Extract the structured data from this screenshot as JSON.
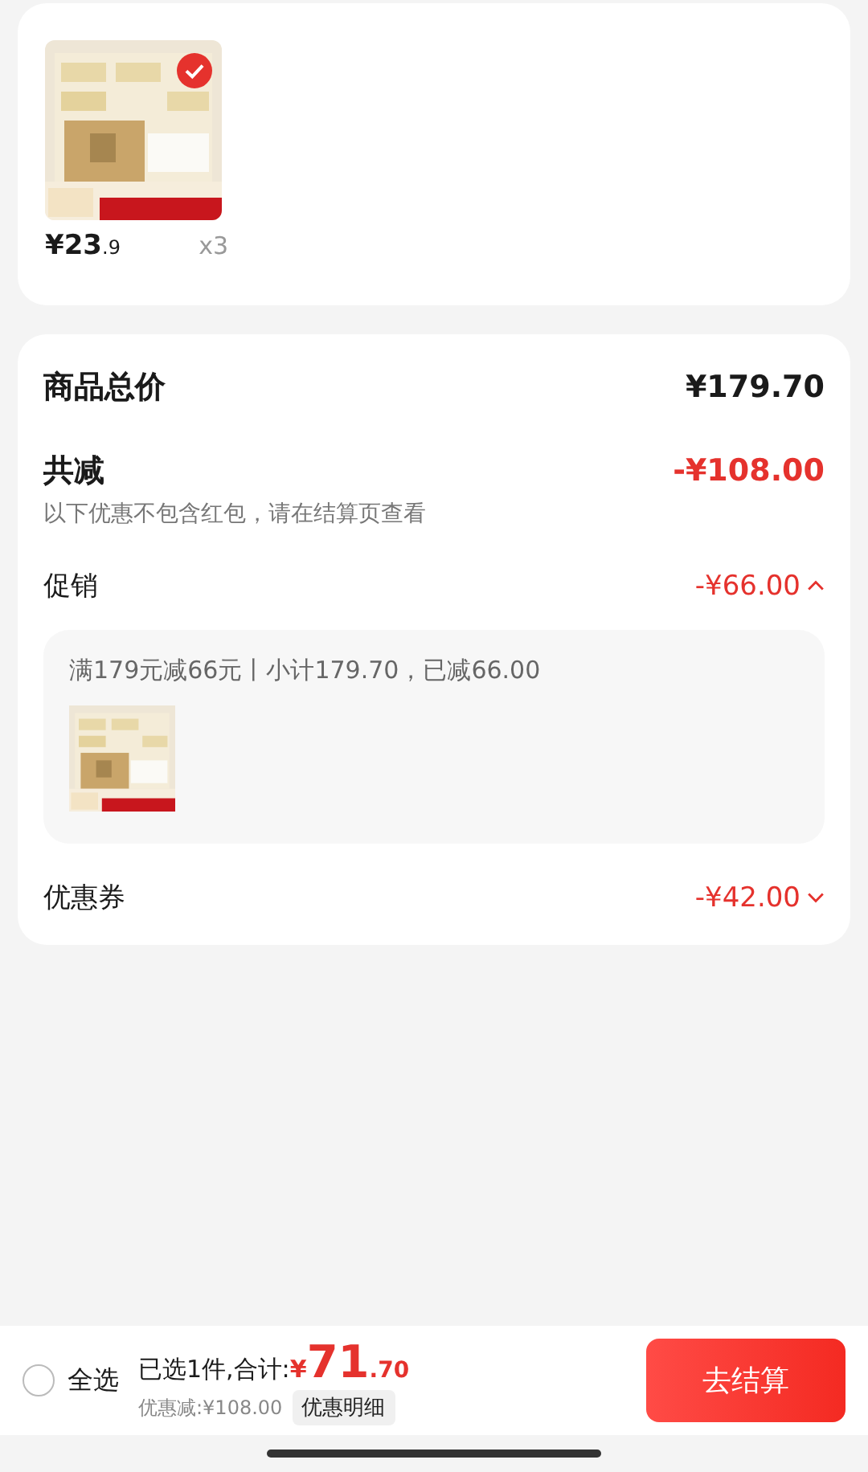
{
  "product_card": {
    "items": [
      {
        "kind": "picture",
        "selected": true,
        "price_main": "¥23",
        "price_decimal": ".9",
        "quantity": "x3"
      }
    ]
  },
  "summary": {
    "total_label": "商品总价",
    "total_value": "¥179.70",
    "discount_label": "共减",
    "discount_value": "-¥108.00",
    "note": "以下优惠不包含红包，请在结算页查看",
    "sections": [
      {
        "label": "促销",
        "value": "-¥66.00",
        "expanded": true,
        "detail": {
          "text": "满179元减66元丨小计179.70，已减66.00"
        }
      },
      {
        "label": "优惠券",
        "value": "-¥42.00",
        "expanded": false
      }
    ]
  },
  "bottom_bar": {
    "select_all": {
      "label": "全选",
      "checked": false
    },
    "selected_text": "已选1件,合计:",
    "currency": "¥",
    "total_main": "71",
    "total_decimal": ".70",
    "discount_text": "优惠减:¥108.00",
    "detail_button": "优惠明细",
    "checkout_button": "去结算"
  }
}
